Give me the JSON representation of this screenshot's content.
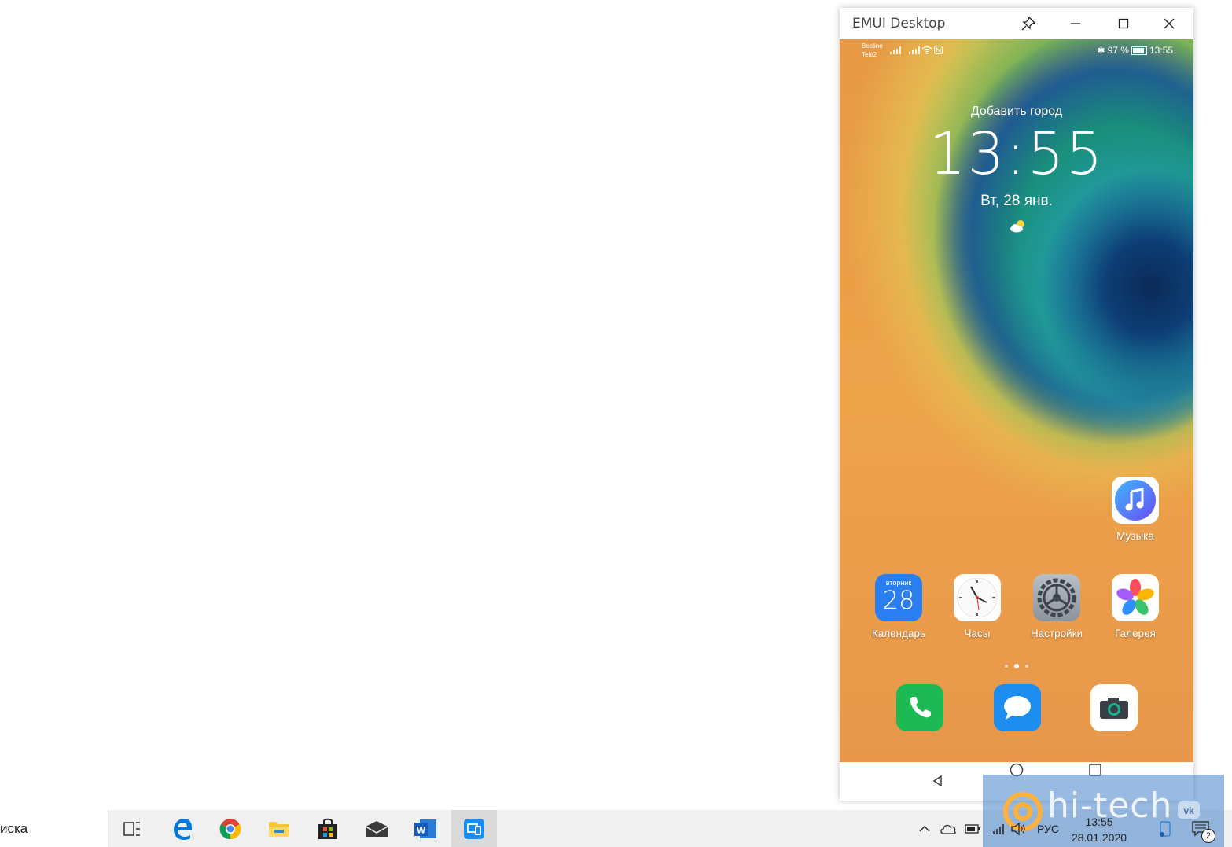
{
  "window": {
    "title": "EMUI Desktop"
  },
  "phone": {
    "status": {
      "carrier1": "Beeline",
      "carrier2": "Tele2",
      "battery": "97 %",
      "time": "13:55"
    },
    "lockscreen": {
      "city": "Добавить город",
      "clock": "13:55",
      "date": "Вт, 28 янв."
    },
    "apps": [
      {
        "label": "Музыка"
      },
      {
        "label": "Календарь",
        "day_name": "вторник",
        "day": "28"
      },
      {
        "label": "Часы"
      },
      {
        "label": "Настройки"
      },
      {
        "label": "Галерея"
      }
    ],
    "dock": [
      {
        "icon": "phone-icon"
      },
      {
        "icon": "messages-icon"
      },
      {
        "icon": "camera-icon"
      }
    ]
  },
  "taskbar": {
    "search_text": "иска",
    "language": "РУС",
    "time": "13:55",
    "date": "28.01.2020",
    "notifications_count": "2"
  },
  "watermark": {
    "text": "hi-tech"
  },
  "colors": {
    "accent": "#0078d7",
    "calendar_blue": "#2a7ef0",
    "phone_green": "#1db954",
    "messages_blue": "#1e8df0"
  }
}
